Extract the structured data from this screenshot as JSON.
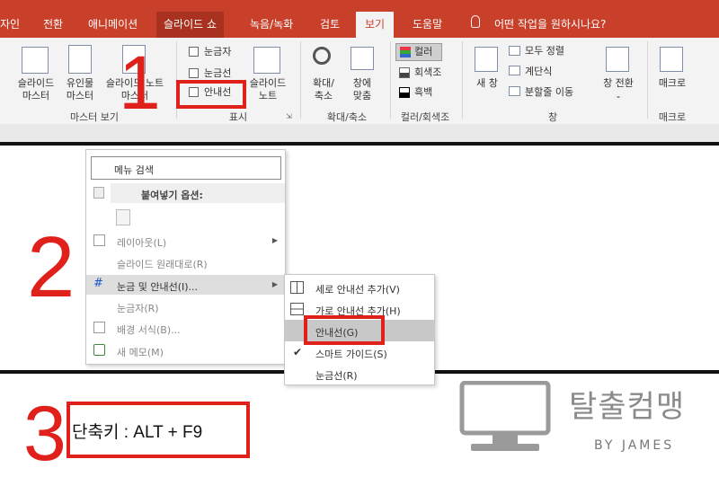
{
  "ribbon_tabs": [
    "자인",
    "전환",
    "애니메이션",
    "슬라이드 쇼",
    "녹음/녹화",
    "검토",
    "보기",
    "도움말"
  ],
  "tell_me": "어떤 작업을 원하시나요?",
  "master_views": {
    "slide_master": [
      "슬라이드",
      "마스터"
    ],
    "handout_master": [
      "유인물",
      "마스터"
    ],
    "notes_master": [
      "슬라이드 노트",
      "마스터"
    ],
    "group": "마스터 보기"
  },
  "show_group": {
    "ruler": "눈금자",
    "gridlines": "눈금선",
    "guides": "안내선",
    "notes": [
      "슬라이드",
      "노트"
    ],
    "group": "표시"
  },
  "zoom_group": {
    "zoom": [
      "확대/",
      "축소"
    ],
    "fit": [
      "창에",
      "맞춤"
    ],
    "group": "확대/축소"
  },
  "color_group": {
    "color": "컬러",
    "grayscale": "회색조",
    "bw": "흑백",
    "group": "컬러/회색조"
  },
  "window_group": {
    "new_window": "새 창",
    "arrange_all": "모두 정렬",
    "cascade": "계단식",
    "move_split": "분할줄 이동",
    "switch": "창 전환",
    "group": "창"
  },
  "macro_group": {
    "macro": "매크로",
    "group": "매크로"
  },
  "steps": {
    "one": "1",
    "two": "2",
    "three": "3"
  },
  "context_menu": {
    "search": "메뉴 검색",
    "paste_options": "붙여넣기 옵션:",
    "layout": "레이아웃(L)",
    "reset_slide": "슬라이드 원래대로(R)",
    "grid_guides": "눈금 및 안내선(I)...",
    "ruler": "눈금자(R)",
    "format_bg": "배경 서식(B)...",
    "new_comment": "새 메모(M)"
  },
  "submenu": {
    "add_vertical": "세로 안내선 추가(V)",
    "add_horizontal": "가로 안내선 추가(H)",
    "guides": "안내선(G)",
    "smart_guides": "스마트 가이드(S)",
    "gridlines": "눈금선(R)"
  },
  "shortcut": "단축키 : ALT + F9",
  "brand": {
    "name": "탈출컴맹",
    "sub": "BY JAMES"
  },
  "colors": {
    "ribbon": "#c8402a",
    "highlight": "#e0201b"
  }
}
